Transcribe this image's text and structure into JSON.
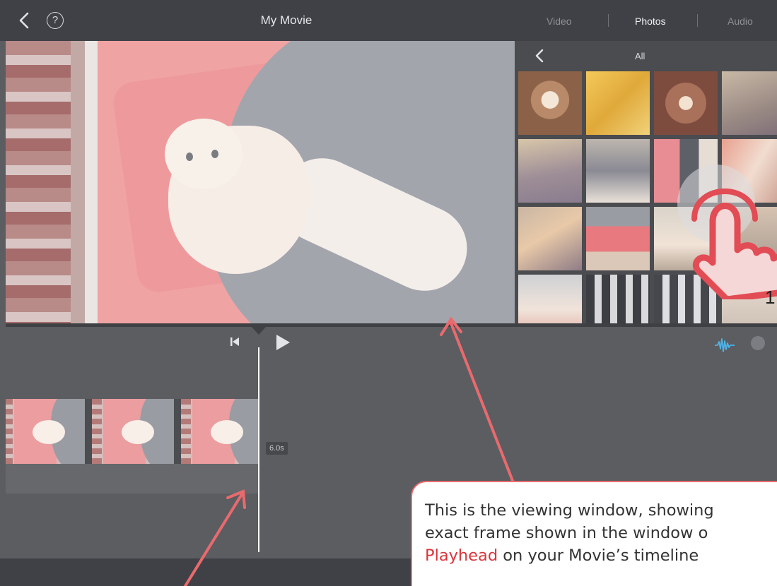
{
  "header": {
    "title": "My Movie",
    "help_glyph": "?",
    "tabs": [
      {
        "label": "Video",
        "active": false
      },
      {
        "label": "Photos",
        "active": true
      },
      {
        "label": "Audio",
        "active": false
      }
    ]
  },
  "browser": {
    "title": "All"
  },
  "timeline": {
    "clip_duration": "6.0s"
  },
  "overlay": {
    "tap_hint_number": "1",
    "callout_line1": "This is the viewing window, showing",
    "callout_line2": "exact frame shown in the window o",
    "callout_line3_highlight": "Playhead",
    "callout_line3_rest": " on your Movie’s timeline"
  },
  "colors": {
    "annotation": "#e96a6e",
    "highlight_text": "#d9353b",
    "audio_icon": "#4fb3e8",
    "toolbar": "#3f4146"
  }
}
